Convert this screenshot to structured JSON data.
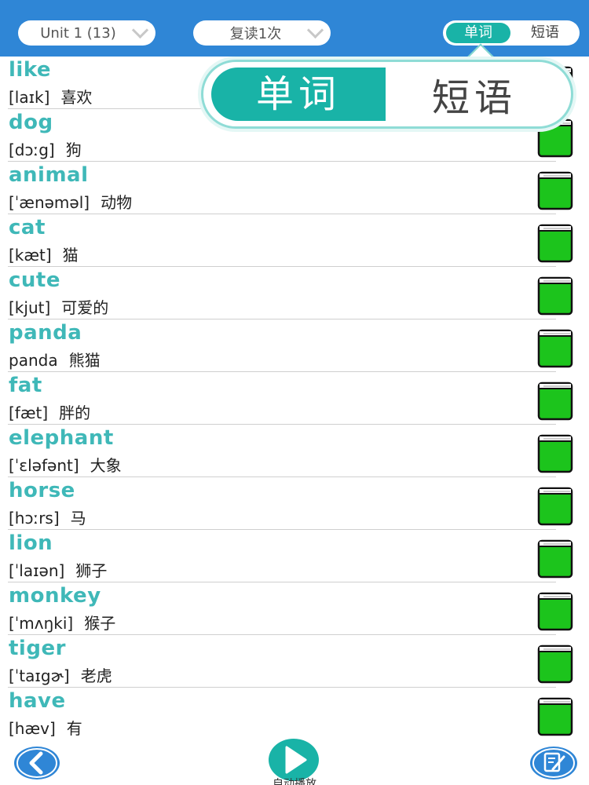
{
  "header": {
    "unit_select": "Unit 1 (13)",
    "repeat_select": "复读1次",
    "toggle": {
      "active": "单词",
      "inactive": "短语"
    }
  },
  "zoom_popup": {
    "active": "单词",
    "inactive": "短语"
  },
  "words": [
    {
      "word": "like",
      "phonetic": "[laɪk]",
      "meaning": "喜欢"
    },
    {
      "word": "dog",
      "phonetic": "[dɔːg]",
      "meaning": "狗"
    },
    {
      "word": "animal",
      "phonetic": "[ˈænəməl]",
      "meaning": "动物"
    },
    {
      "word": "cat",
      "phonetic": "[kæt]",
      "meaning": "猫"
    },
    {
      "word": "cute",
      "phonetic": "[kjut]",
      "meaning": "可爱的"
    },
    {
      "word": "panda",
      "phonetic": "panda",
      "meaning": "熊猫"
    },
    {
      "word": "fat",
      "phonetic": "[fæt]",
      "meaning": "胖的"
    },
    {
      "word": "elephant",
      "phonetic": "[ˈɛləfənt]",
      "meaning": "大象"
    },
    {
      "word": "horse",
      "phonetic": "[hɔːrs]",
      "meaning": "马"
    },
    {
      "word": "lion",
      "phonetic": "[ˈlaɪən]",
      "meaning": "狮子"
    },
    {
      "word": "monkey",
      "phonetic": "[ˈmʌŋki]",
      "meaning": "猴子"
    },
    {
      "word": "tiger",
      "phonetic": "[ˈtaɪgɚ]",
      "meaning": "老虎"
    },
    {
      "word": "have",
      "phonetic": "[hæv]",
      "meaning": "有"
    }
  ],
  "footer": {
    "play_caption": "自动播放",
    "icons": [
      "back-arrow-icon",
      "play-icon",
      "edit-note-icon"
    ]
  },
  "colors": {
    "header_bg": "#2f86d6",
    "accent_teal": "#19b3a7",
    "word_text": "#3fb8b8",
    "book_green": "#1cc41c"
  }
}
